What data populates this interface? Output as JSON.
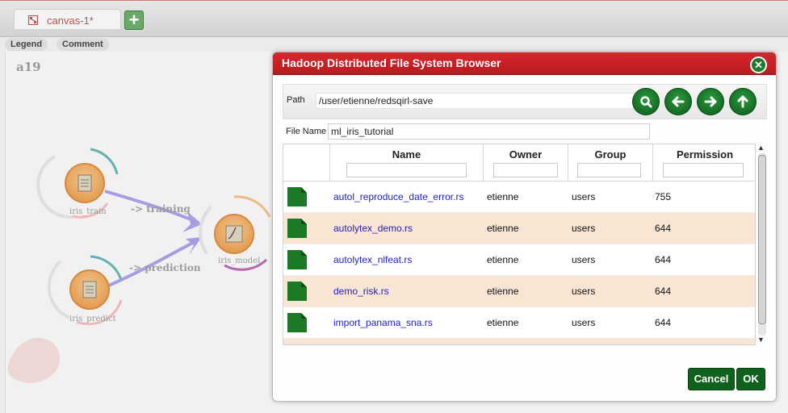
{
  "tabs": [
    {
      "label": "canvas-1*"
    }
  ],
  "canvas": {
    "toolbar": {
      "legend": "Legend",
      "comment": "Comment"
    },
    "title": "a19",
    "nodes": [
      {
        "label": "iris_train"
      },
      {
        "label": "iris_predict"
      },
      {
        "label": "iris_model"
      }
    ],
    "links": [
      {
        "label": "-> training"
      },
      {
        "label": "-> prediction"
      }
    ]
  },
  "dialog": {
    "title": "Hadoop Distributed File System Browser",
    "path_label": "Path",
    "path_value": "/user/etienne/redsqirl-save",
    "file_name_label": "File Name",
    "file_name_value": "ml_iris_tutorial",
    "columns": [
      "Name",
      "Owner",
      "Group",
      "Permission"
    ],
    "rows": [
      {
        "name": "autol_reproduce_date_error.rs",
        "owner": "etienne",
        "group": "users",
        "permission": "755"
      },
      {
        "name": "autolytex_demo.rs",
        "owner": "etienne",
        "group": "users",
        "permission": "644"
      },
      {
        "name": "autolytex_nlfeat.rs",
        "owner": "etienne",
        "group": "users",
        "permission": "644"
      },
      {
        "name": "demo_risk.rs",
        "owner": "etienne",
        "group": "users",
        "permission": "644"
      },
      {
        "name": "import_panama_sna.rs",
        "owner": "etienne",
        "group": "users",
        "permission": "644"
      }
    ],
    "cancel_label": "Cancel",
    "ok_label": "OK"
  },
  "colors": {
    "dialog_header": "#c8202a",
    "button_green": "#10601e",
    "row_alt": "#f8e5d3",
    "file_icon": "#1a7a25",
    "tab_text": "#c0504d"
  },
  "icons": {
    "tab": "canvas-icon",
    "add_tab": "plus-icon",
    "close": "close-icon",
    "search": "search-icon",
    "back": "arrow-left-icon",
    "forward": "arrow-right-icon",
    "up": "arrow-up-icon",
    "file": "file-icon"
  }
}
